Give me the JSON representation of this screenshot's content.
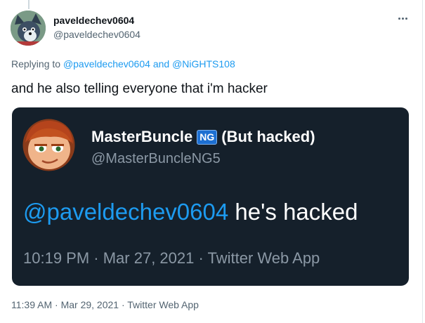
{
  "tweet": {
    "author_name": "paveldechev0604",
    "author_handle": "@paveldechev0604",
    "more_icon": "more-horizontal-icon",
    "reply": {
      "prefix": "Replying to",
      "mention_1": "@paveldechev0604",
      "joiner": "and",
      "mention_2": "@NiGHTS108"
    },
    "text": "and he also telling everyone that i'm hacker",
    "timestamp": "11:39 AM",
    "separator": "·",
    "date": "Mar 29, 2021",
    "source": "Twitter Web App"
  },
  "embedded": {
    "display_name": "MasterBuncle",
    "badge": "NG",
    "name_suffix": "(But hacked)",
    "handle": "@MasterBuncleNG5",
    "mention": "@paveldechev0604",
    "text": "he's hacked",
    "meta": "10:19 PM · Mar 27, 2021 · Twitter Web App"
  },
  "colors": {
    "link": "#1d9bf0",
    "muted": "#536471",
    "embed_bg": "#15202b",
    "embed_muted": "#8b98a5"
  }
}
